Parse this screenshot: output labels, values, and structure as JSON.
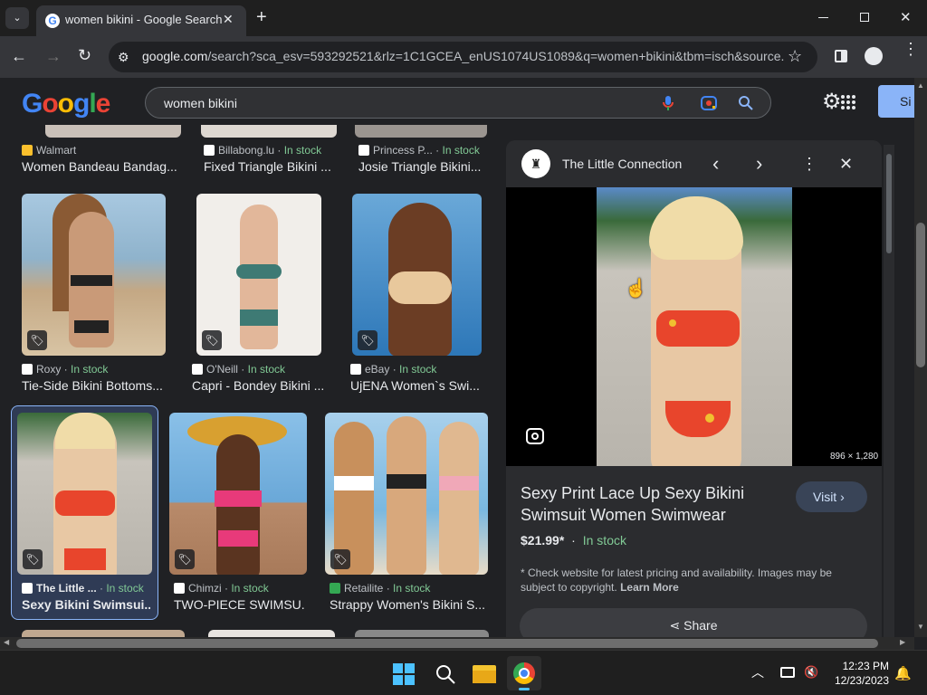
{
  "browser": {
    "tab_title": "women bikini - Google Search",
    "url_host": "google.com",
    "url_rest": "/search?sca_esv=593292521&rlz=1C1GCEA_enUS1074US1089&q=women+bikini&tbm=isch&source..."
  },
  "google": {
    "logo_letters": [
      "G",
      "o",
      "o",
      "g",
      "l",
      "e"
    ],
    "query": "women bikini",
    "signin_label": "Si"
  },
  "results": [
    {
      "source": "Walmart",
      "stock": "",
      "title": "Women Bandeau Bandag..."
    },
    {
      "source": "Billabong.lu",
      "stock": "In stock",
      "title": "Fixed Triangle Bikini ..."
    },
    {
      "source": "Princess P...",
      "stock": "In stock",
      "title": "Josie Triangle Bikini..."
    },
    {
      "source": "Roxy",
      "stock": "In stock",
      "title": "Tie-Side Bikini Bottoms..."
    },
    {
      "source": "O'Neill",
      "stock": "In stock",
      "title": "Capri - Bondey Bikini ..."
    },
    {
      "source": "eBay",
      "stock": "In stock",
      "title": "UjENA Women`s Swi..."
    },
    {
      "source": "The Little ...",
      "stock": "In stock",
      "title": "Sexy Bikini Swimsui..."
    },
    {
      "source": "Chimzi",
      "stock": "In stock",
      "title": "TWO-PIECE SWIMSU..."
    },
    {
      "source": "Retailite",
      "stock": "In stock",
      "title": "Strappy Women's Bikini S..."
    }
  ],
  "panel": {
    "site_name": "The Little Connection",
    "image_dims": "896 × 1,280",
    "product_title_line1": "Sexy Print Lace Up Sexy Bikini",
    "product_title_line2": "Swimsuit Women Swimwear",
    "price": "$21.99*",
    "separator": "·",
    "stock": "In stock",
    "visit_label": "Visit",
    "disclaimer": "* Check website for latest pricing and availability. Images may be subject to copyright.",
    "learn_more": "Learn More",
    "share_label": "Share"
  },
  "taskbar": {
    "time": "12:23 PM",
    "date": "12/23/2023"
  },
  "colors": {
    "accent_blue": "#8ab4f8",
    "in_stock_green": "#81c995",
    "bg_dark": "#202124"
  }
}
